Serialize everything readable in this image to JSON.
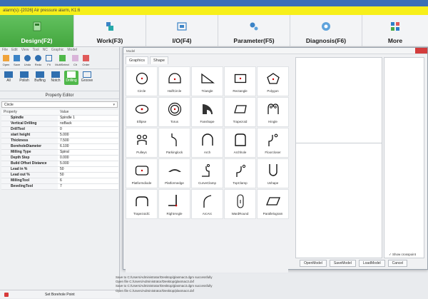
{
  "title_bar": {
    "text": ""
  },
  "alarm": {
    "text": "alarm(s):-[2026] Air pressure alarm, K1:6"
  },
  "nav": [
    {
      "label": "Design(F2)",
      "icon": "design-icon",
      "active": true
    },
    {
      "label": "Work(F3)",
      "icon": "work-icon",
      "active": false
    },
    {
      "label": "I/O(F4)",
      "icon": "io-icon",
      "active": false
    },
    {
      "label": "Parameter(F5)",
      "icon": "gears-icon",
      "active": false
    },
    {
      "label": "Diagnosis(F6)",
      "icon": "diagnosis-icon",
      "active": false
    },
    {
      "label": "More",
      "icon": "more-icon",
      "active": false
    }
  ],
  "left": {
    "menu": [
      "File",
      "Edit",
      "View",
      "Tool",
      "NC",
      "Graphic",
      "Model"
    ],
    "toolbar1": [
      {
        "label": "Open"
      },
      {
        "label": "Save"
      },
      {
        "label": "Undo"
      },
      {
        "label": "Redo"
      },
      {
        "label": "Fit"
      },
      {
        "label": "MultiSelect"
      },
      {
        "label": "Clr"
      },
      {
        "label": "Order"
      }
    ],
    "toolbar2": [
      {
        "label": "All",
        "selected": false
      },
      {
        "label": "Polish",
        "selected": false
      },
      {
        "label": "Buffing",
        "selected": false
      },
      {
        "label": "Notch",
        "selected": false
      },
      {
        "label": "Drilling",
        "selected": true
      },
      {
        "label": "Groove",
        "selected": false
      }
    ],
    "property_editor_title": "Property Editor",
    "shape_combo": "Circle",
    "prop_header": {
      "key": "Property",
      "value": "Value"
    },
    "props": [
      {
        "key": "Spindle",
        "value": "Spindle 1"
      },
      {
        "key": "Vertical Drilling",
        "value": "noBack"
      },
      {
        "key": "DrillTool",
        "value": "0"
      },
      {
        "key": "start height",
        "value": "5.000"
      },
      {
        "key": "Thickness",
        "value": "7.500"
      },
      {
        "key": "BoreholeDiameter",
        "value": "6.100"
      },
      {
        "key": "Milling Type",
        "value": "Spiral"
      },
      {
        "key": "Depth Step",
        "value": "0.000"
      },
      {
        "key": "Build Offset Distance",
        "value": "5.000"
      },
      {
        "key": "Lead in %",
        "value": "50"
      },
      {
        "key": "Lead out %",
        "value": "50"
      },
      {
        "key": "MillingTool",
        "value": "6"
      },
      {
        "key": "BevelingTool",
        "value": "7"
      }
    ],
    "bottom_button": "Set Borehole Point"
  },
  "log": [
    "Save to C:/Users/Administrator/Desktop/glasmac3.dgm successfully",
    "Open file C:/Users/Administrator/Desktop/glasmac3.dxf",
    "Save to C:/Users/Administrator/Desktop/glasmac3.dgm successfully",
    "Open file C:/Users/Administrator/Desktop/plasmac4.dxf"
  ],
  "modal": {
    "title": "Model",
    "tabs": [
      {
        "label": "Graphics",
        "active": true
      },
      {
        "label": "Shape",
        "active": false
      }
    ],
    "shapes": [
      {
        "label": "Circle",
        "icon": "circle-icon"
      },
      {
        "label": "HalfCircle",
        "icon": "halfcircle-icon"
      },
      {
        "label": "Triangle",
        "icon": "triangle-icon"
      },
      {
        "label": "Rectangle",
        "icon": "rectangle-icon"
      },
      {
        "label": "Polygon",
        "icon": "polygon-icon"
      },
      {
        "label": "Ellipse",
        "icon": "ellipse-icon"
      },
      {
        "label": "Torus",
        "icon": "torus-icon"
      },
      {
        "label": "Fanshape",
        "icon": "fanshape-icon"
      },
      {
        "label": "Trapezoid",
        "icon": "trapezoid-icon"
      },
      {
        "label": "Hingle",
        "icon": "hinge-icon"
      },
      {
        "label": "Pulleys",
        "icon": "pulleys-icon"
      },
      {
        "label": "Parkinglock",
        "icon": "parkinglock-icon"
      },
      {
        "label": "Arch",
        "icon": "arch-icon"
      },
      {
        "label": "Archhole",
        "icon": "archhole-icon"
      },
      {
        "label": "Floorcloser",
        "icon": "floorcloser-icon"
      },
      {
        "label": "Platformdiode",
        "icon": "platformdiode-icon"
      },
      {
        "label": "Platformedge",
        "icon": "platformedge-icon"
      },
      {
        "label": "CurveClamp",
        "icon": "curveclamp-icon"
      },
      {
        "label": "TopClamp",
        "icon": "topclamp-icon"
      },
      {
        "label": "Ushape",
        "icon": "ushape-icon"
      },
      {
        "label": "TrapezoidC",
        "icon": "trapezoidc-icon"
      },
      {
        "label": "RightAngle",
        "icon": "rightangle-icon"
      },
      {
        "label": "ArcArc",
        "icon": "arcarc-icon"
      },
      {
        "label": "WardRound",
        "icon": "wardround-icon"
      },
      {
        "label": "Parallelogram",
        "icon": "parallelogram-icon"
      }
    ],
    "show_crosspoint": "✓ Show crosspoint",
    "buttons": [
      "OpenModel",
      "SaveModel",
      "LoadModel",
      "Cancel"
    ]
  }
}
